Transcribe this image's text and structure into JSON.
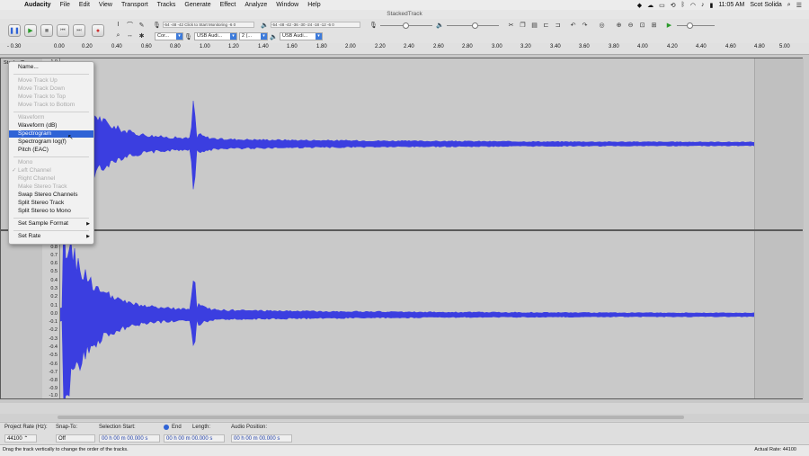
{
  "menubar": {
    "app_name": "Audacity",
    "items": [
      "File",
      "Edit",
      "View",
      "Transport",
      "Tracks",
      "Generate",
      "Effect",
      "Analyze",
      "Window",
      "Help"
    ],
    "clock": "11:05 AM",
    "user": "Scot Solida"
  },
  "window": {
    "title": "StackedTrack"
  },
  "toolbar": {
    "record_meter_hint": "Click to Start Monitoring",
    "record_meter_scale": "-54  -48  -42",
    "record_meter_tail": "-6  0",
    "play_meter_scale": "-54  -48  -42  -36  -30  -24  -18  -12  -6  0",
    "host": "Cor...",
    "recording_device": "USB Audi...",
    "recording_channels": "2 (...",
    "playback_device": "USB Audi..."
  },
  "ruler": {
    "ticks": [
      "- 0.30",
      "0.00",
      "0.20",
      "0.40",
      "0.60",
      "0.80",
      "1.00",
      "1.20",
      "1.40",
      "1.60",
      "1.80",
      "2.00",
      "2.20",
      "2.40",
      "2.60",
      "2.80",
      "3.00",
      "3.20",
      "3.40",
      "3.60",
      "3.80",
      "4.00",
      "4.20",
      "4.40",
      "4.60",
      "4.80",
      "5.00"
    ]
  },
  "track": {
    "name": "StackedTra",
    "scale_top_visible": "1.0",
    "scale_bottom": [
      "0.8",
      "0.7",
      "0.6",
      "0.5",
      "0.4",
      "0.3",
      "0.2",
      "0.1",
      "0.0",
      "-0.1",
      "-0.2",
      "-0.3",
      "-0.4",
      "-0.5",
      "-0.6",
      "-0.7",
      "-0.8",
      "-0.9",
      "-1.0"
    ]
  },
  "track_menu": {
    "items": [
      {
        "label": "Name...",
        "enabled": true
      },
      {
        "label": "Move Track Up",
        "enabled": false
      },
      {
        "label": "Move Track Down",
        "enabled": false
      },
      {
        "label": "Move Track to Top",
        "enabled": false
      },
      {
        "label": "Move Track to Bottom",
        "enabled": false
      },
      {
        "label": "Waveform",
        "enabled": false
      },
      {
        "label": "Waveform (dB)",
        "enabled": true
      },
      {
        "label": "Spectrogram",
        "enabled": true,
        "highlighted": true
      },
      {
        "label": "Spectrogram log(f)",
        "enabled": true
      },
      {
        "label": "Pitch (EAC)",
        "enabled": true
      },
      {
        "label": "Mono",
        "enabled": false
      },
      {
        "label": "Left Channel",
        "enabled": false,
        "checked": true
      },
      {
        "label": "Right Channel",
        "enabled": false
      },
      {
        "label": "Make Stereo Track",
        "enabled": false
      },
      {
        "label": "Swap Stereo Channels",
        "enabled": true
      },
      {
        "label": "Split Stereo Track",
        "enabled": true
      },
      {
        "label": "Split Stereo to Mono",
        "enabled": true
      },
      {
        "label": "Set Sample Format",
        "enabled": true,
        "submenu": true
      },
      {
        "label": "Set Rate",
        "enabled": true,
        "submenu": true
      }
    ]
  },
  "selection_bar": {
    "project_rate_label": "Project Rate (Hz):",
    "project_rate": "44100",
    "snap_to_label": "Snap-To:",
    "snap_to": "Off",
    "selection_start_label": "Selection Start:",
    "end_label": "End",
    "length_label": "Length:",
    "audio_position_label": "Audio Position:",
    "selection_start": "00 h 00 m 00.000 s",
    "end": "00 h 00 m 00.000 s",
    "audio_position": "00 h 00 m 00.000 s"
  },
  "status": {
    "message": "Drag the track vertically to change the order of the tracks.",
    "actual_rate": "Actual Rate: 44100"
  },
  "colors": {
    "waveform": "#3b3ee0",
    "selection_highlight": "#2f63d6",
    "track_bg": "#c9c9c9"
  }
}
